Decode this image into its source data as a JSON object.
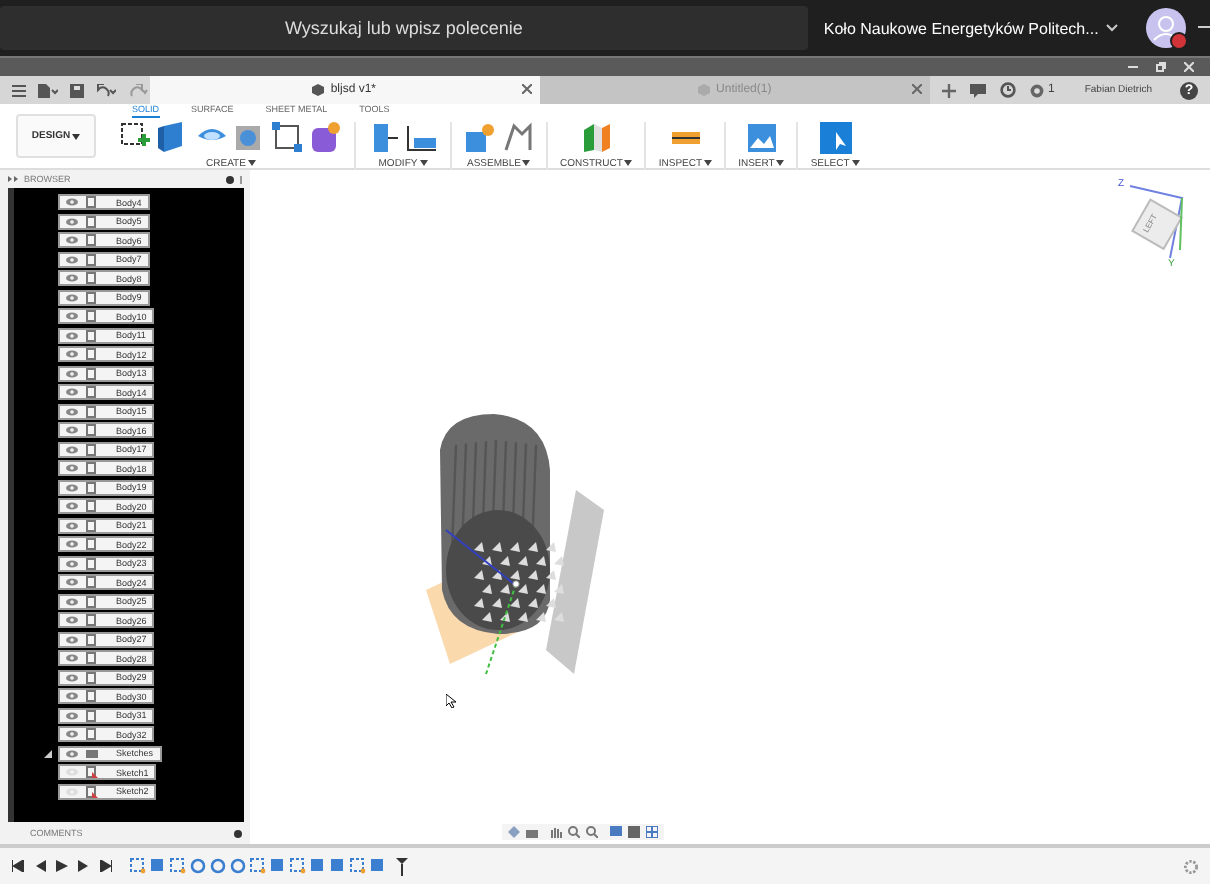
{
  "top_bar": {
    "search": {
      "placeholder": "Wyszukaj lub wpisz polecenie"
    },
    "team": "Koło Naukowe Energetyków Politech...",
    "account_online": false
  },
  "document_tabs": [
    {
      "label": "bljsd v1*",
      "selected": true
    },
    {
      "label": "Untitled(1)",
      "selected": false
    }
  ],
  "job_count": "1",
  "user": "Fabian Dietrich",
  "help": "?",
  "workspace": "DESIGN",
  "ribbon_tabs": [
    {
      "label": "SOLID",
      "selected": true
    },
    {
      "label": "SURFACE",
      "selected": false
    },
    {
      "label": "SHEET METAL",
      "selected": false
    },
    {
      "label": "TOOLS",
      "selected": false
    }
  ],
  "ribbon_groups": [
    "CREATE",
    "MODIFY",
    "ASSEMBLE",
    "CONSTRUCT",
    "INSPECT",
    "INSERT",
    "SELECT"
  ],
  "browser": {
    "title": "BROWSER",
    "items": [
      {
        "kind": "body",
        "label": "Body4",
        "visible": true
      },
      {
        "kind": "body",
        "label": "Body5",
        "visible": true
      },
      {
        "kind": "body",
        "label": "Body6",
        "visible": true
      },
      {
        "kind": "body",
        "label": "Body7",
        "visible": true
      },
      {
        "kind": "body",
        "label": "Body8",
        "visible": true
      },
      {
        "kind": "body",
        "label": "Body9",
        "visible": true
      },
      {
        "kind": "body",
        "label": "Body10",
        "visible": true
      },
      {
        "kind": "body",
        "label": "Body11",
        "visible": true
      },
      {
        "kind": "body",
        "label": "Body12",
        "visible": true
      },
      {
        "kind": "body",
        "label": "Body13",
        "visible": true
      },
      {
        "kind": "body",
        "label": "Body14",
        "visible": true
      },
      {
        "kind": "body",
        "label": "Body15",
        "visible": true
      },
      {
        "kind": "body",
        "label": "Body16",
        "visible": true
      },
      {
        "kind": "body",
        "label": "Body17",
        "visible": true
      },
      {
        "kind": "body",
        "label": "Body18",
        "visible": true
      },
      {
        "kind": "body",
        "label": "Body19",
        "visible": true
      },
      {
        "kind": "body",
        "label": "Body20",
        "visible": true
      },
      {
        "kind": "body",
        "label": "Body21",
        "visible": true
      },
      {
        "kind": "body",
        "label": "Body22",
        "visible": true
      },
      {
        "kind": "body",
        "label": "Body23",
        "visible": true
      },
      {
        "kind": "body",
        "label": "Body24",
        "visible": true
      },
      {
        "kind": "body",
        "label": "Body25",
        "visible": true
      },
      {
        "kind": "body",
        "label": "Body26",
        "visible": true
      },
      {
        "kind": "body",
        "label": "Body27",
        "visible": true
      },
      {
        "kind": "body",
        "label": "Body28",
        "visible": true
      },
      {
        "kind": "body",
        "label": "Body29",
        "visible": true
      },
      {
        "kind": "body",
        "label": "Body30",
        "visible": true
      },
      {
        "kind": "body",
        "label": "Body31",
        "visible": true
      },
      {
        "kind": "body",
        "label": "Body32",
        "visible": true
      },
      {
        "kind": "folder",
        "label": "Sketches",
        "visible": true,
        "expanded": true,
        "children": [
          {
            "kind": "sketch",
            "label": "Sketch1",
            "visible": false
          },
          {
            "kind": "sketch",
            "label": "Sketch2",
            "visible": false
          }
        ]
      }
    ]
  },
  "comments": {
    "title": "COMMENTS"
  },
  "view_cube": {
    "face": "LEFT",
    "axis_x": "Z",
    "axis_y": "Y"
  }
}
